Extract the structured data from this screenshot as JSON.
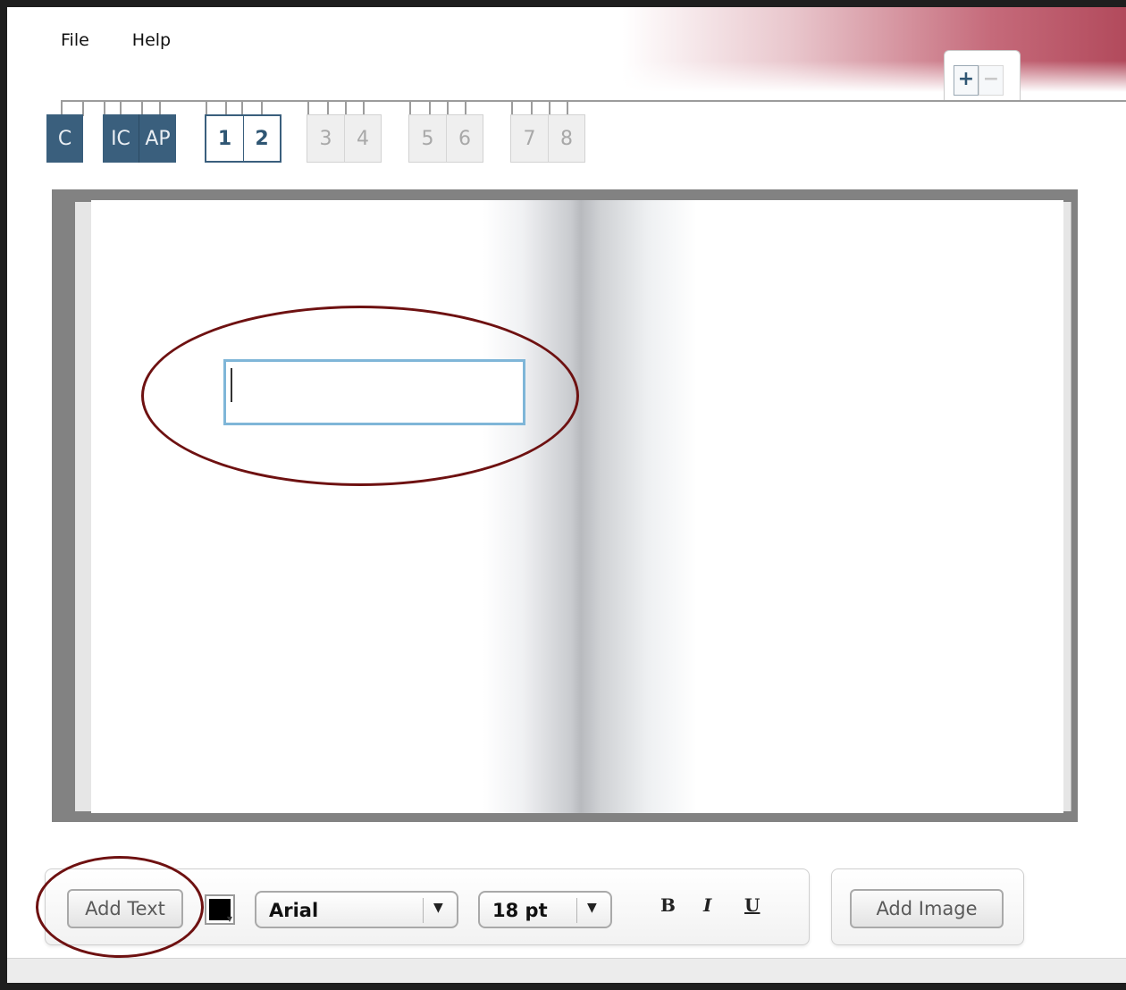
{
  "menu": {
    "file": "File",
    "help": "Help"
  },
  "page_tools": {
    "add_icon": "plus-icon",
    "remove_icon": "minus-icon"
  },
  "tabs": {
    "cover": "C",
    "inside_cover": "IC",
    "ap": "AP",
    "p1": "1",
    "p2": "2",
    "p3": "3",
    "p4": "4",
    "p5": "5",
    "p6": "6",
    "p7": "7",
    "p8": "8"
  },
  "editor": {
    "text_box_value": ""
  },
  "toolbar": {
    "add_text": "Add Text",
    "color_swatch": "#000000",
    "font": "Arial",
    "size": "18 pt",
    "bold": "B",
    "italic": "I",
    "underline": "U",
    "add_image": "Add Image"
  },
  "colors": {
    "accent": "#3a5f7d",
    "annotation": "#6e1111",
    "text_box_border": "#7fb6d8"
  }
}
